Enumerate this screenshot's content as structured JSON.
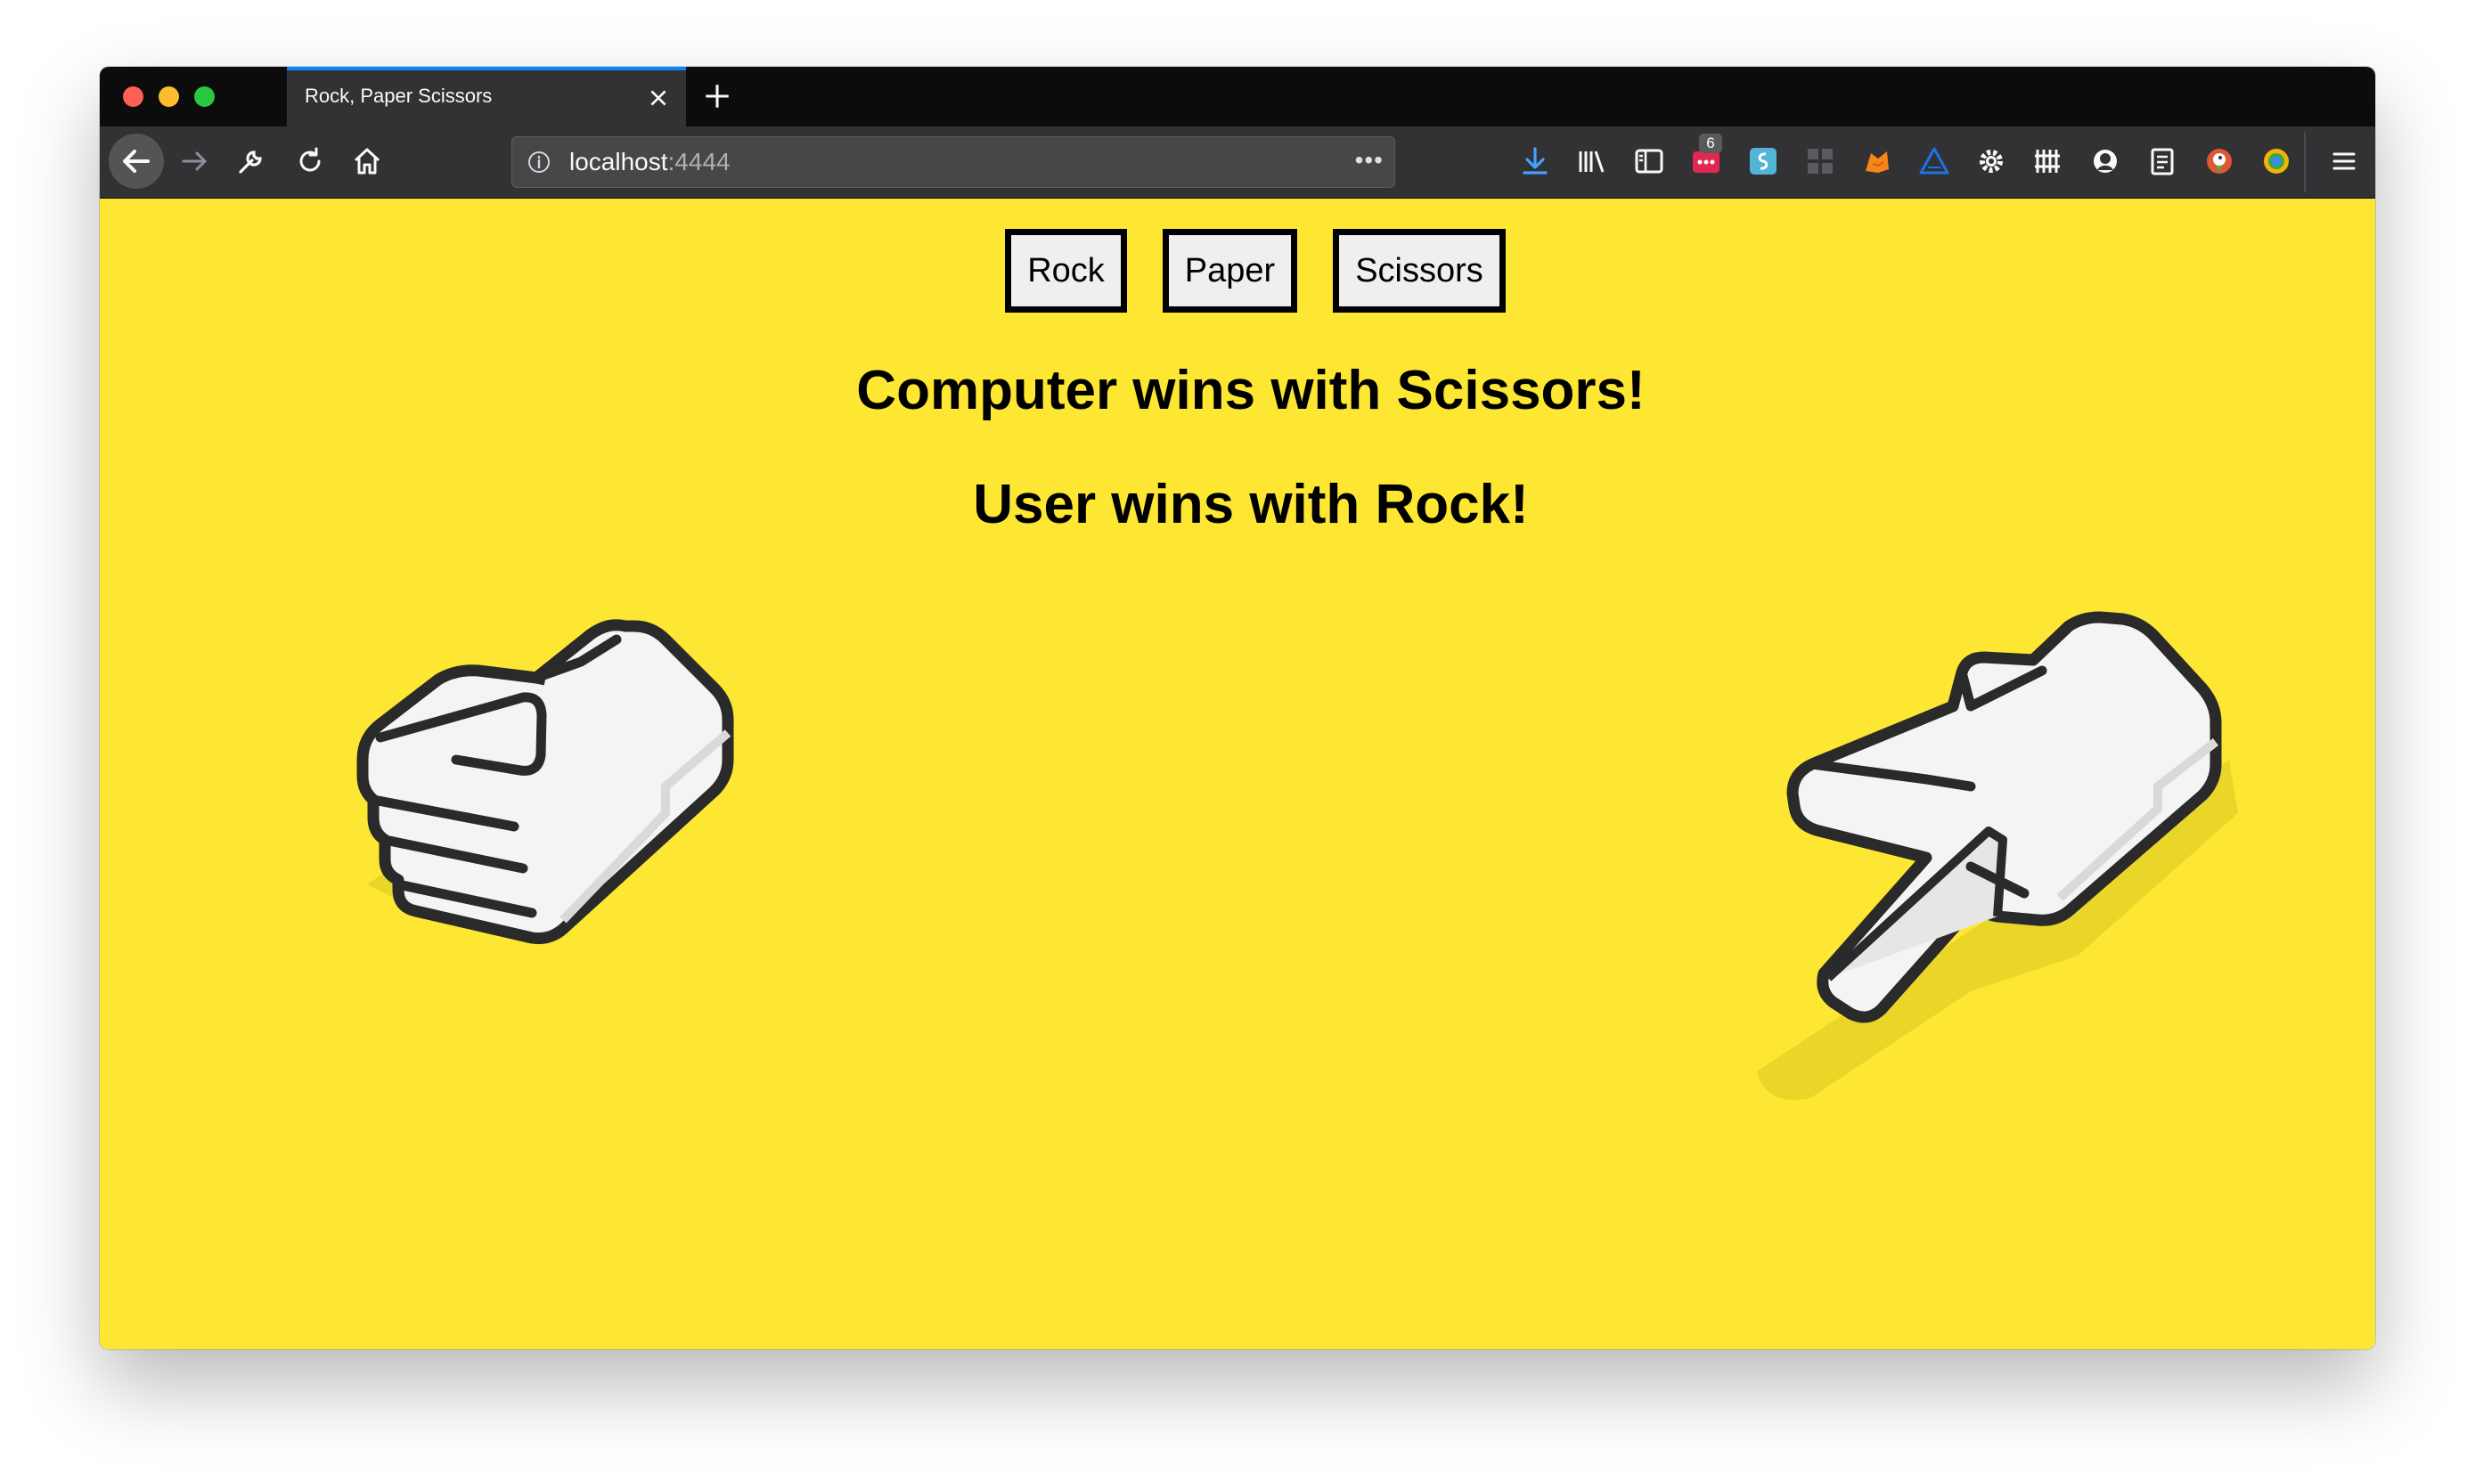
{
  "browser": {
    "tab_title": "Rock, Paper Scissors",
    "url_host": "localhost",
    "url_port": ":4444",
    "url_more": "•••",
    "notification_badge": "6",
    "colors": {
      "tab_accent": "#0a84ff",
      "chrome_dark": "#0c0c0d",
      "chrome": "#323234"
    },
    "toolbar_icons": [
      "download-icon",
      "library-icon",
      "sidebar-icon",
      "extension-red-icon",
      "extension-blue-icon",
      "extension-grid-icon",
      "metamask-icon",
      "extension-triangle-icon",
      "gear-icon",
      "extension-fence-icon",
      "extension-face-icon",
      "clipboard-icon",
      "duckduckgo-icon",
      "extension-globe-icon",
      "menu-icon"
    ]
  },
  "game": {
    "buttons": {
      "rock": "Rock",
      "paper": "Paper",
      "scissors": "Scissors"
    },
    "computer_result": "Computer wins with Scissors!",
    "user_result": "User wins with Rock!",
    "left_hand": "rock",
    "right_hand": "scissors",
    "colors": {
      "background": "#fde732",
      "button_bg": "#efefef",
      "text": "#000000"
    }
  }
}
